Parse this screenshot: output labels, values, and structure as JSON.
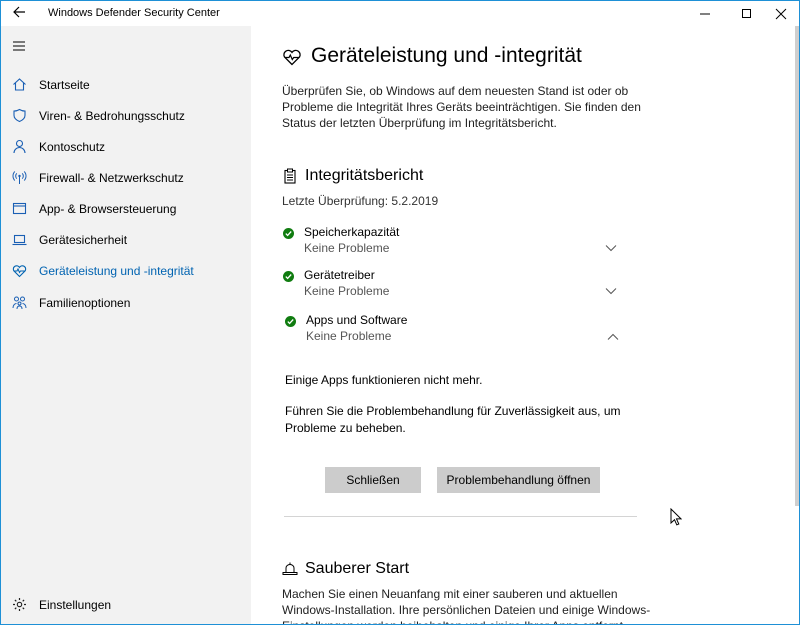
{
  "window": {
    "title": "Windows Defender Security Center",
    "accent": "#0063b1",
    "ok_color": "#107c10"
  },
  "sidebar": {
    "items": [
      {
        "label": "Startseite",
        "icon": "home-icon"
      },
      {
        "label": "Viren- & Bedrohungsschutz",
        "icon": "shield-icon"
      },
      {
        "label": "Kontoschutz",
        "icon": "person-icon"
      },
      {
        "label": "Firewall- & Netzwerkschutz",
        "icon": "antenna-icon"
      },
      {
        "label": "App- & Browsersteuerung",
        "icon": "browser-window-icon"
      },
      {
        "label": "Gerätesicherheit",
        "icon": "laptop-icon"
      },
      {
        "label": "Geräteleistung und -integrität",
        "icon": "heart-pulse-icon",
        "active": true
      },
      {
        "label": "Familienoptionen",
        "icon": "family-icon"
      }
    ],
    "settings_label": "Einstellungen"
  },
  "main": {
    "title": "Geräteleistung und -integrität",
    "description": "Überprüfen Sie, ob Windows auf dem neuesten Stand ist oder ob Probleme die Integrität Ihres Geräts beeinträchtigen. Sie finden den Status der letzten Überprüfung im Integritätsbericht.",
    "report": {
      "title": "Integritätsbericht",
      "last_check": "Letzte Überprüfung: 5.2.2019",
      "items": [
        {
          "name": "Speicherkapazität",
          "status": "Keine Probleme",
          "expanded": false
        },
        {
          "name": "Gerätetreiber",
          "status": "Keine Probleme",
          "expanded": false
        },
        {
          "name": "Apps und Software",
          "status": "Keine Probleme",
          "expanded": true
        }
      ],
      "detail_line1": "Einige Apps funktionieren nicht mehr.",
      "detail_line2": "Führen Sie die Problembehandlung für Zuverlässigkeit aus, um Probleme zu beheben.",
      "close_button": "Schließen",
      "troubleshoot_button": "Problembehandlung öffnen"
    },
    "fresh_start": {
      "title": "Sauberer Start",
      "description": "Machen Sie einen Neuanfang mit einer sauberen und aktuellen Windows-Installation. Ihre persönlichen Dateien und einige Windows-Einstellungen werden beibehalten und einige Ihrer Apps entfernt."
    }
  }
}
